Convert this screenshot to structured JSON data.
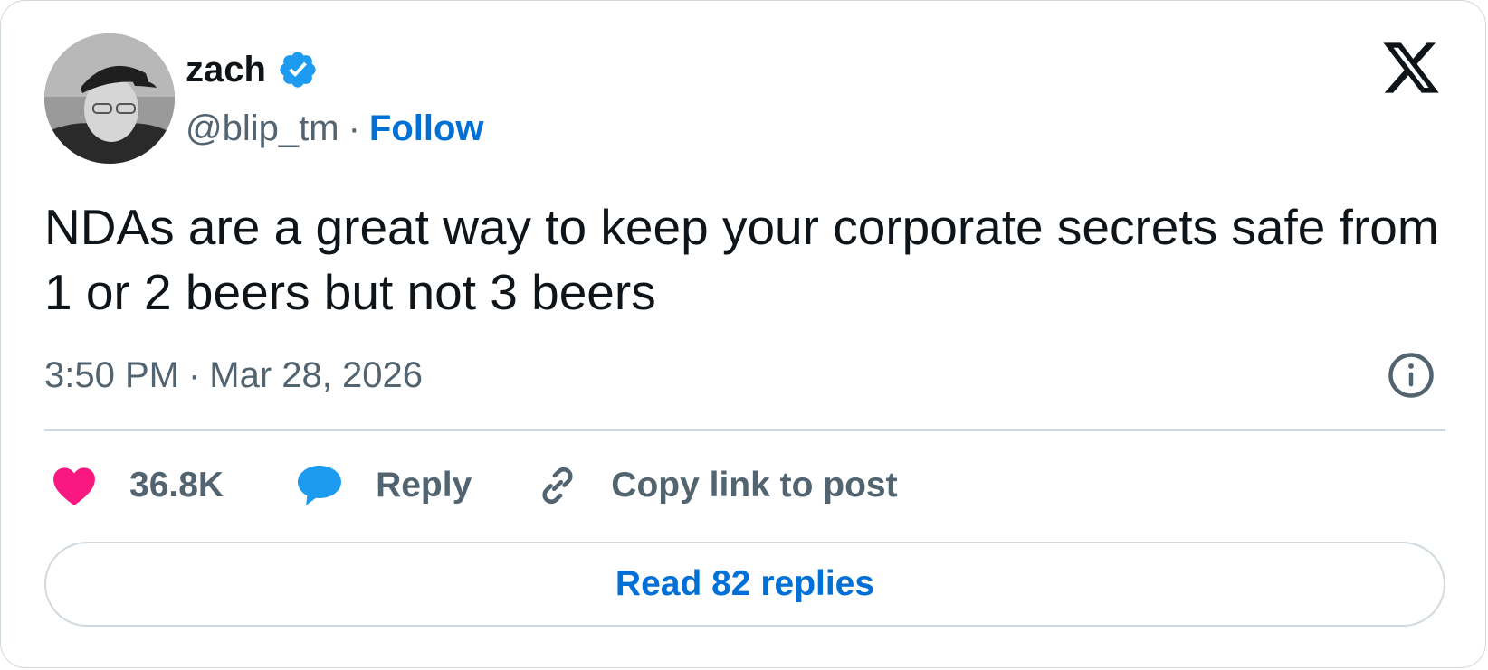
{
  "author": {
    "name": "zach",
    "handle": "@blip_tm",
    "separator": "·",
    "follow_label": "Follow",
    "verified": true
  },
  "post": {
    "text": "NDAs are a great way to keep your corporate secrets safe from 1 or 2 beers but not 3 beers",
    "time": "3:50 PM",
    "date_separator": "·",
    "date": "Mar 28, 2026"
  },
  "actions": {
    "like_count": "36.8K",
    "reply_label": "Reply",
    "copy_link_label": "Copy link to post"
  },
  "read_replies_label": "Read 82 replies",
  "icons": {
    "brand": "x-logo-icon",
    "verified": "verified-badge-icon",
    "info": "info-icon",
    "like": "heart-icon",
    "reply": "speech-bubble-icon",
    "copy": "link-icon"
  },
  "colors": {
    "text": "#0f1419",
    "secondary": "#536471",
    "link": "#006fd6",
    "verified": "#1d9bf0",
    "like": "#f91880",
    "reply": "#1d9bf0",
    "border": "#cfd9de"
  }
}
